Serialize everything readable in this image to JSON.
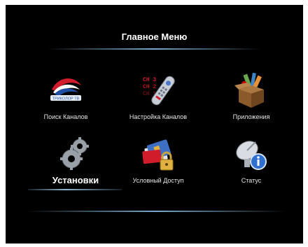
{
  "menu": {
    "title": "Главное Меню",
    "items": [
      {
        "label": "Поиск Каналов",
        "icon": "satellite-tricolor-logo-icon",
        "selected": false
      },
      {
        "label": "Настройка Каналов",
        "icon": "remote-control-channels-icon",
        "selected": false
      },
      {
        "label": "Приложения",
        "icon": "applications-box-icon",
        "selected": false
      },
      {
        "label": "Установки",
        "icon": "gears-icon",
        "selected": true
      },
      {
        "label": "Условный Доступ",
        "icon": "smartcard-lock-icon",
        "selected": false
      },
      {
        "label": "Статус",
        "icon": "dish-info-icon",
        "selected": false
      }
    ],
    "logo_text": "ТРИКОЛОР ТВ",
    "channel_texts": [
      "CH 3",
      "CH 2",
      "CH 1"
    ]
  },
  "colors": {
    "background": "#000000",
    "accent_line": "#7aa9c8",
    "text": "#ffffff"
  }
}
